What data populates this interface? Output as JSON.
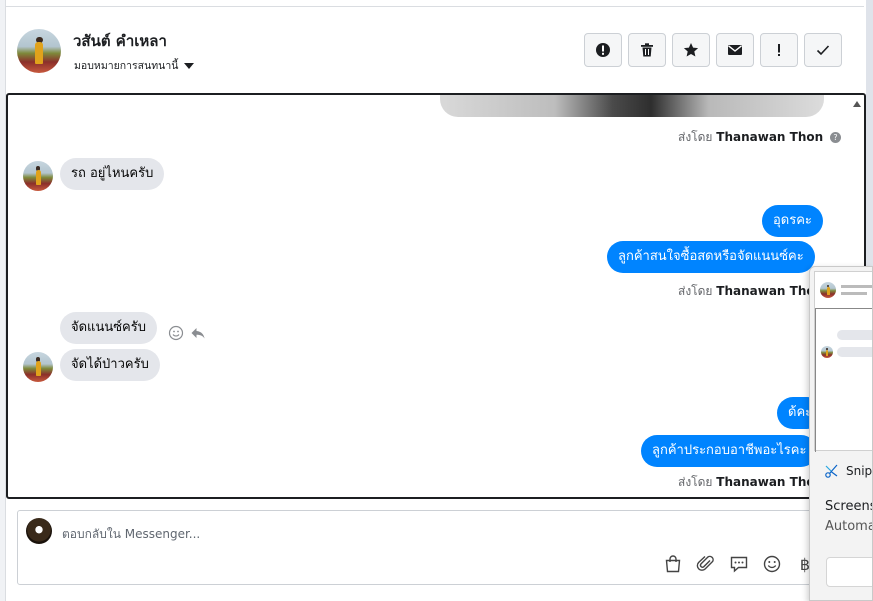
{
  "header": {
    "contact_name": "วสันต์ คำเหลา",
    "assign_label": "มอบหมายการสนทนานี้"
  },
  "actions": [
    {
      "icon": "exclamation-circle-icon",
      "label": "spam"
    },
    {
      "icon": "trash-icon",
      "label": "delete"
    },
    {
      "icon": "star-icon",
      "label": "star"
    },
    {
      "icon": "envelope-icon",
      "label": "mark-unread"
    },
    {
      "icon": "exclamation-icon",
      "label": "follow-up"
    },
    {
      "icon": "check-icon",
      "label": "done"
    }
  ],
  "messages": {
    "sent_by_prefix": "ส่งโดย",
    "sender": "Thanawan Thon",
    "help_glyph": "?",
    "m1_in": "รถ อยู่ไหนครับ",
    "m2_out": "อุดรคะ",
    "m3_out": "ลูกค้าสนใจซื้อสดหรือจัดแนนซ์คะ",
    "m4_in": "จัดแนนซ์ครับ",
    "m5_in": "จัดได้ป่าวครับ",
    "m6_out": "ด้คะ",
    "m7_out": "ลูกค้าประกอบอาชีพอะไรคะ"
  },
  "composer": {
    "placeholder": "ตอบกลับใน Messenger...",
    "tools": [
      "shopping-bag-icon",
      "paperclip-icon",
      "chat-bubble-icon",
      "smiley-icon",
      "baht-icon"
    ],
    "baht_glyph": "฿"
  },
  "snip": {
    "app_name": "Snip",
    "line1": "Screens",
    "line2": "Automa"
  }
}
